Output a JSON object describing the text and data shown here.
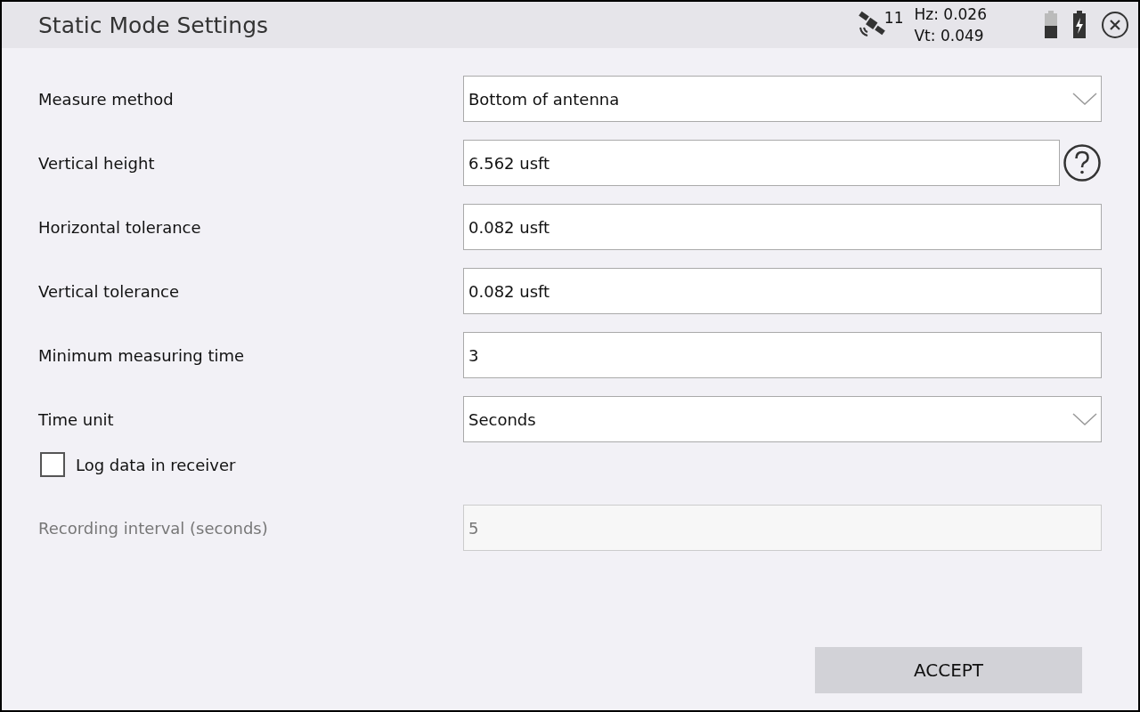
{
  "window": {
    "title": "Static Mode Settings"
  },
  "status": {
    "satellites": "11",
    "hz": "Hz: 0.026",
    "vt": "Vt: 0.049"
  },
  "fields": [
    {
      "kind": "select",
      "label": "Measure method",
      "value": "Bottom of antenna",
      "disabled": false,
      "help": false
    },
    {
      "kind": "text",
      "label": "Vertical height",
      "value": "6.562 usft",
      "disabled": false,
      "help": true
    },
    {
      "kind": "text",
      "label": "Horizontal tolerance",
      "value": "0.082 usft",
      "disabled": false,
      "help": false
    },
    {
      "kind": "text",
      "label": "Vertical tolerance",
      "value": "0.082 usft",
      "disabled": false,
      "help": false
    },
    {
      "kind": "text",
      "label": "Minimum measuring time",
      "value": "3",
      "disabled": false,
      "help": false
    },
    {
      "kind": "select",
      "label": "Time unit",
      "value": "Seconds",
      "disabled": false,
      "help": false
    },
    {
      "kind": "checkbox",
      "label": "Log data in receiver",
      "checked": false
    },
    {
      "kind": "text",
      "label": "Recording interval (seconds)",
      "value": "5",
      "disabled": true,
      "help": false
    }
  ],
  "buttons": [
    "ACCEPT"
  ]
}
